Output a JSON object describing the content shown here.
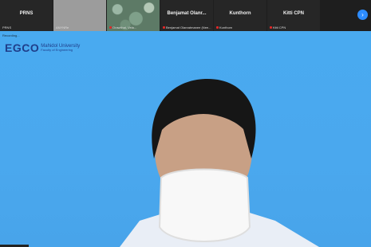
{
  "participants": [
    {
      "name": "PRNS",
      "caption": "PRNS",
      "style": "dark",
      "muted": false
    },
    {
      "name": "",
      "caption": "ANYNRe",
      "style": "gray",
      "muted": false
    },
    {
      "name": "",
      "caption": "Orawithai, Vela...",
      "style": "plants",
      "muted": true
    },
    {
      "name": "Benjamat  Olanr...",
      "caption": "Benjamat Olanratmanee (Nee...",
      "style": "dark",
      "muted": true
    },
    {
      "name": "Kunthorn",
      "caption": "Kunthorn",
      "style": "dark",
      "muted": true
    },
    {
      "name": "Kitti CPN",
      "caption": "Kitti CPN",
      "style": "dark",
      "muted": true
    }
  ],
  "main": {
    "recording_label": "Recording...",
    "logo_mark": "EGCO",
    "logo_title": "Mahidol University",
    "logo_sub": "Faculty of Engineering"
  },
  "icons": {
    "next": "chevron-right-icon"
  },
  "colors": {
    "background": "#49aaf0",
    "accent": "#2d8cff"
  }
}
